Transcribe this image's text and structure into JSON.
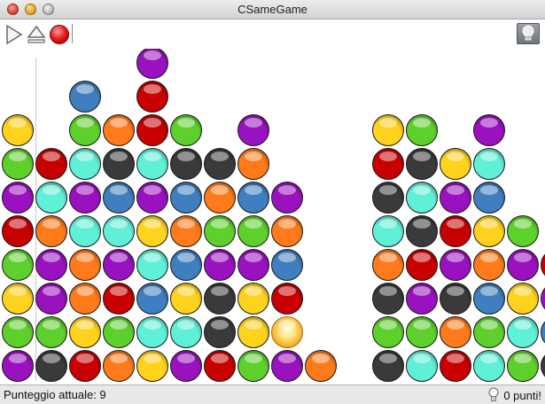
{
  "window": {
    "title": "CSameGame"
  },
  "toolbar": {
    "play_icon": "play-icon",
    "eject_icon": "eject-icon",
    "stop_icon": "stop-icon",
    "hint_icon": "lightbulb-icon"
  },
  "status": {
    "score_text": "Punteggio attuale: 9",
    "hint_points_text": "0 punti!"
  },
  "colors": {
    "red": "#c80000",
    "green": "#5ed02c",
    "purple": "#9a11bf",
    "yellow": "#ffd21e",
    "orange": "#ff7a1a",
    "cyan": "#5ff0d8",
    "blue": "#3f7fbf",
    "black": "#3a3a3a",
    "highlight": "#ffd54a"
  },
  "board": {
    "columns": [
      [
        "purple",
        "green",
        "yellow",
        "green",
        "red",
        "purple",
        "green",
        "yellow"
      ],
      [
        "black",
        "green",
        "purple",
        "purple",
        "orange",
        "cyan",
        "red"
      ],
      [
        "red",
        "yellow",
        "orange",
        "orange",
        "cyan",
        "purple",
        "cyan",
        "green",
        "blue"
      ],
      [
        "orange",
        "green",
        "red",
        "purple",
        "cyan",
        "blue",
        "black",
        "orange"
      ],
      [
        "yellow",
        "cyan",
        "blue",
        "cyan",
        "yellow",
        "purple",
        "cyan",
        "red",
        "red",
        "purple"
      ],
      [
        "purple",
        "cyan",
        "yellow",
        "blue",
        "orange",
        "blue",
        "black",
        "green"
      ],
      [
        "red",
        "black",
        "black",
        "purple",
        "green",
        "orange",
        "black"
      ],
      [
        "green",
        "yellow",
        "yellow",
        "purple",
        "green",
        "blue",
        "orange",
        "purple"
      ],
      [
        "purple",
        "highlight",
        "red",
        "blue",
        "orange",
        "purple"
      ],
      [
        "orange"
      ],
      [],
      [
        "black",
        "green",
        "black",
        "orange",
        "cyan",
        "black",
        "red",
        "yellow"
      ],
      [
        "cyan",
        "green",
        "purple",
        "red",
        "black",
        "cyan",
        "black",
        "green"
      ],
      [
        "red",
        "orange",
        "black",
        "purple",
        "red",
        "purple",
        "yellow"
      ],
      [
        "cyan",
        "green",
        "blue",
        "orange",
        "yellow",
        "blue",
        "cyan",
        "purple"
      ],
      [
        "green",
        "cyan",
        "yellow",
        "purple",
        "green"
      ],
      [
        "black",
        "blue",
        "purple",
        "red"
      ]
    ]
  }
}
